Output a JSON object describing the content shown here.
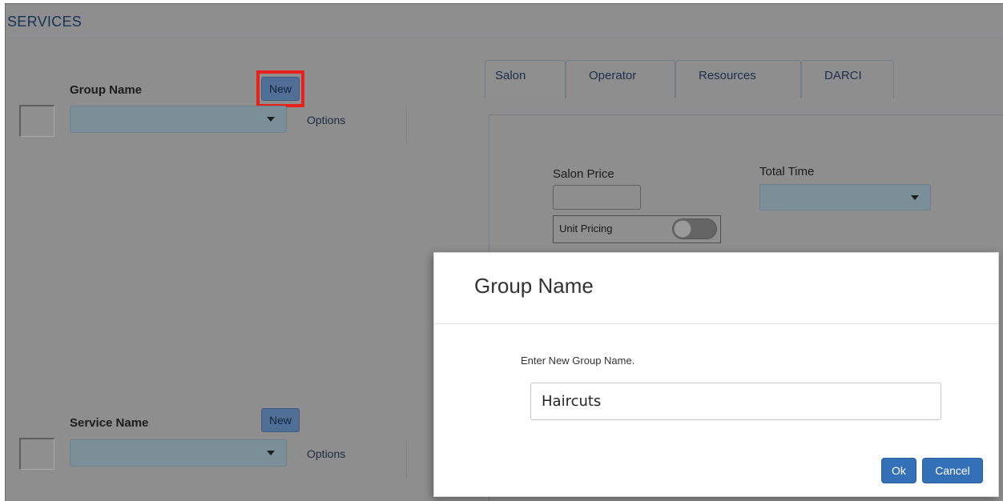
{
  "header": {
    "title": "SERVICES"
  },
  "group": {
    "label": "Group Name",
    "new_label": "New",
    "options_label": "Options",
    "selected_value": ""
  },
  "service": {
    "label": "Service Name",
    "new_label": "New",
    "options_label": "Options",
    "selected_value": ""
  },
  "tabs": [
    {
      "label": "Salon",
      "active": true
    },
    {
      "label": "Operator",
      "active": false
    },
    {
      "label": "Resources",
      "active": false
    },
    {
      "label": "DARCI",
      "active": false
    }
  ],
  "salon_panel": {
    "salon_price_label": "Salon Price",
    "salon_price_value": "",
    "total_time_label": "Total Time",
    "total_time_value": "",
    "unit_pricing_label": "Unit Pricing",
    "unit_pricing_on": false
  },
  "modal": {
    "title": "Group Name",
    "prompt": "Enter New Group Name.",
    "input_value": "Haircuts",
    "ok_label": "Ok",
    "cancel_label": "Cancel"
  },
  "colors": {
    "highlight": "#e8211b",
    "primary_button": "#3370b7",
    "overlay": "#8e8e8e"
  }
}
